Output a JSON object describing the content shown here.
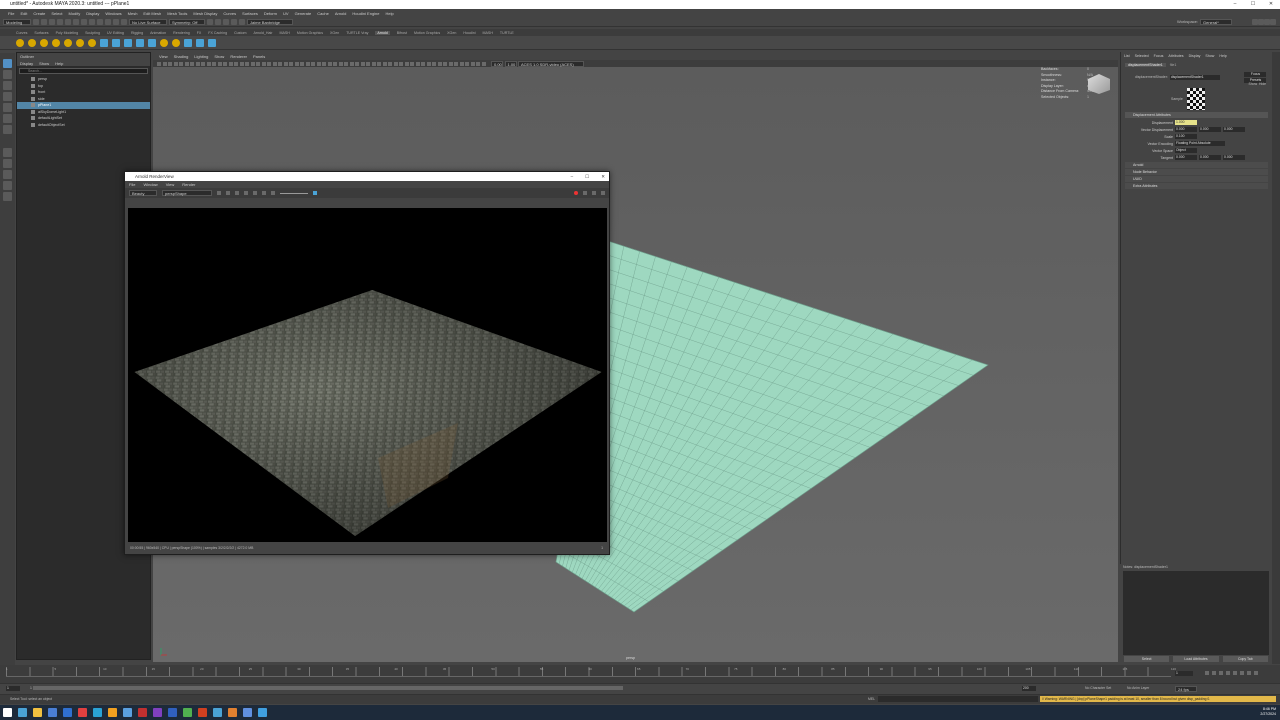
{
  "app": {
    "title": "untitled* - Autodesk MAYA 2020.3: untitled   ---   pPlane1",
    "controls": [
      "–",
      "☐",
      "✕"
    ]
  },
  "menubar": [
    "File",
    "Edit",
    "Create",
    "Select",
    "Modify",
    "Display",
    "Windows",
    "Mesh",
    "Edit Mesh",
    "Mesh Tools",
    "Mesh Display",
    "Curves",
    "Surfaces",
    "Deform",
    "UV",
    "Generate",
    "Cache",
    "Arnold",
    "Houdini Engine",
    "Help"
  ],
  "statusline": {
    "mode": "Modeling",
    "live_surface": "No Live Surface",
    "symmetry": "Symmetry: Off",
    "user": "Jaime Banbridge",
    "workspace_label": "Workspace:",
    "workspace": "General*"
  },
  "shelf_tabs": [
    "Curves",
    "Surfaces",
    "Poly Modeling",
    "Sculpting",
    "UV Editing",
    "Rigging",
    "Animation",
    "Rendering",
    "FX",
    "FX Caching",
    "Custom",
    "Arnold_Hair",
    "MASH",
    "Motion Graphics",
    "XGen",
    "TURTLE Vray",
    "Arnold",
    "Bifrost",
    "Motion Graphics",
    "XGen",
    "Houdini",
    "MASH",
    "TURTLE"
  ],
  "shelf_active": "Arnold",
  "outliner": {
    "title": "Outliner",
    "menu": [
      "Display",
      "Show",
      "Help"
    ],
    "search_placeholder": "Search...",
    "items": [
      "persp",
      "top",
      "front",
      "side",
      "pPlane1",
      "aiSkyDomeLight1",
      "defaultLightSet",
      "defaultObjectSet"
    ],
    "selected": "pPlane1"
  },
  "viewport": {
    "menu": [
      "View",
      "Shading",
      "Lighting",
      "Show",
      "Renderer",
      "Panels"
    ],
    "exposure": "0.00",
    "gamma": "1.00",
    "colorspace": "ACES 1.0 SDR-video (ACES)",
    "camera_label": "persp",
    "hud": [
      {
        "k": "Backfaces:",
        "v": "0"
      },
      {
        "k": "Smoothness:",
        "v": "N/A"
      },
      {
        "k": "Instance:",
        "v": "N/A"
      },
      {
        "k": "Display Layer:",
        "v": "default"
      },
      {
        "k": "Distance From Camera:",
        "v": "41.396"
      },
      {
        "k": "Selected Objects:",
        "v": "1"
      }
    ]
  },
  "render_view": {
    "title": "Arnold RenderView",
    "menu": [
      "File",
      "Window",
      "View",
      "Render"
    ],
    "preset": "Beauty",
    "camera": "perspShape",
    "status": "00:00:55 | 960x540 | CPU | perspShape (100%) | samples 3/2/2/2/2/2 | 4272.0 MB",
    "status_right": "1"
  },
  "attribute_editor": {
    "tabs": [
      "List",
      "Selected",
      "Focus",
      "Attributes",
      "Display",
      "Show",
      "Help"
    ],
    "node_tab": "displacementShader1",
    "node_tab2": "file1",
    "node_label": "displacementShader:",
    "node_name": "displacementShader1",
    "focus_btn": "Focus",
    "presets_btn": "Presets",
    "show_btn": "Show",
    "hide_btn": "Hide",
    "sample_label": "Sample",
    "section": "Displacement Attributes",
    "rows": [
      {
        "label": "Displacement",
        "values": [
          "1.000"
        ],
        "hl": true
      },
      {
        "label": "Vector Displacement",
        "values": [
          "0.000",
          "0.000",
          "0.000"
        ]
      },
      {
        "label": "Scale",
        "values": [
          "0.100"
        ],
        "hl": false
      },
      {
        "label": "Vector Encoding",
        "values": [
          "Floating Point Absolute"
        ]
      },
      {
        "label": "Vector Space",
        "values": [
          "Object"
        ]
      },
      {
        "label": "Tangent",
        "values": [
          "0.000",
          "0.000",
          "0.000"
        ]
      }
    ],
    "collapsed_sections": [
      "Arnold",
      "Node Behavior",
      "UUID",
      "Extra Attributes"
    ],
    "notes_label": "Notes: displacementShader1",
    "buttons": [
      "Select",
      "Load Attributes",
      "Copy Tab"
    ]
  },
  "timeline": {
    "ticks": [
      "1",
      "5",
      "10",
      "15",
      "20",
      "25",
      "30",
      "35",
      "40",
      "45",
      "50",
      "55",
      "60",
      "65",
      "70",
      "75",
      "80",
      "85",
      "90",
      "95",
      "100",
      "105",
      "110",
      "115",
      "120"
    ],
    "current": "1",
    "range_start": "1",
    "range_inner_start": "1",
    "range_inner_end": "200",
    "range_end": "200",
    "char_set": "No Character Set",
    "anim_layer": "No Anim Layer",
    "fps": "24 fps"
  },
  "helpline": {
    "text": "Select Tool: select an object",
    "mel_label": "MEL",
    "warning": "// Warning: WARNING | [dxp] pPlaneShape1 padding is at least 10, smaller than 8 bound but given disp_padding 0."
  },
  "taskbar": {
    "time": "8:46 PM",
    "date": "2/27/2024",
    "icon_colors": [
      "#ffffff",
      "#4aa3d6",
      "#f0c040",
      "#4a7fd6",
      "#3070d0",
      "#e04040",
      "#2aa3d6",
      "#f0a020",
      "#5aa0e0",
      "#c03030",
      "#8040c0",
      "#3060c0",
      "#50b050",
      "#d04020",
      "#4aa3d6",
      "#e08030",
      "#6090e0",
      "#40a0e0"
    ]
  },
  "colors": {
    "ui_bg": "#444444",
    "accent": "#5285a6",
    "viewport_bg": "#646464",
    "plane": "#9ed8c0",
    "warning": "#e2b84a"
  }
}
